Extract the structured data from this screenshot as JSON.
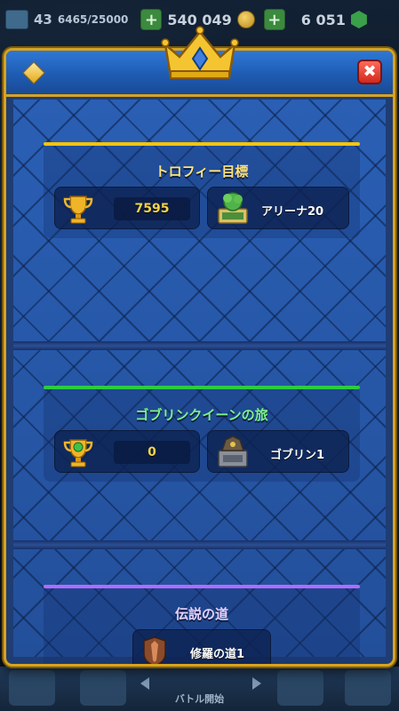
{
  "topbar": {
    "level": "43",
    "xp": "6465/25000",
    "gold": "540 049",
    "gems": "6 051"
  },
  "modal": {
    "sections": [
      {
        "title": "トロフィー目標",
        "accent_color": "#f1c40f",
        "title_color": "#ffe27a",
        "value": "7595",
        "label": "アリーナ20"
      },
      {
        "title": "ゴブリンクイーンの旅",
        "accent_color": "#2ecc40",
        "title_color": "#7cf08c",
        "value": "0",
        "label": "ゴブリン1"
      },
      {
        "title": "伝説の道",
        "accent_color": "#b06cff",
        "title_color": "#e6d2ff",
        "label": "修羅の道1"
      }
    ],
    "close_symbol": "✖"
  },
  "bottom_nav": {
    "battle_label": "バトル開始"
  }
}
